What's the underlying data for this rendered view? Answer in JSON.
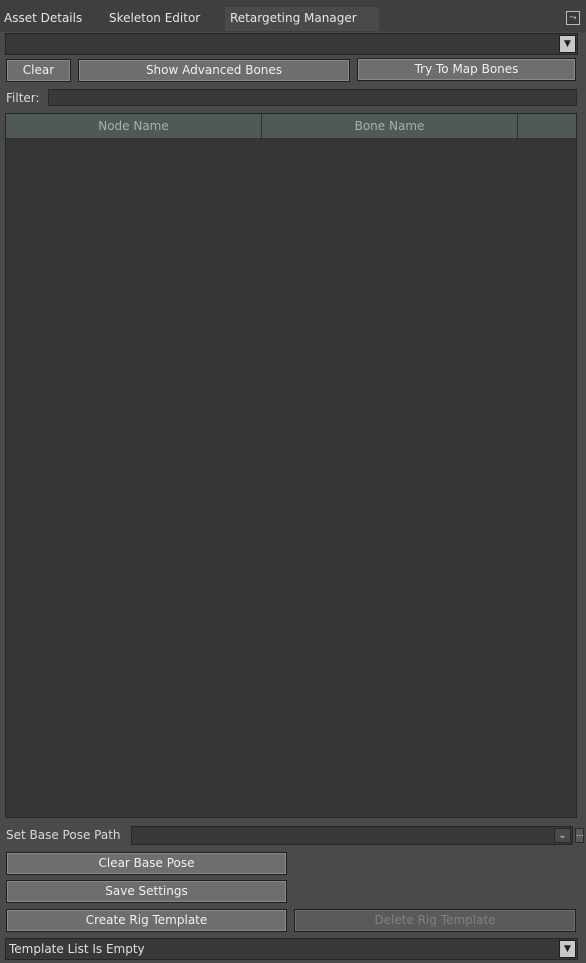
{
  "tabs": [
    {
      "label": "Asset Details"
    },
    {
      "label": "Skeleton Editor"
    },
    {
      "label": "Retargeting Manager",
      "active": true
    }
  ],
  "toolbar": {
    "clear_label": "Clear",
    "show_advanced_bones_label": "Show Advanced Bones",
    "try_to_map_bones_label": "Try To Map Bones"
  },
  "filter": {
    "label": "Filter:",
    "value": ""
  },
  "table": {
    "columns": [
      "Node Name",
      "Bone Name",
      ""
    ],
    "rows": []
  },
  "base_pose": {
    "label": "Set Base Pose Path",
    "value": "",
    "clear_label": "Clear Base Pose",
    "save_label": "Save Settings"
  },
  "rig": {
    "create_label": "Create Rig Template",
    "delete_label": "Delete Rig Template",
    "template_list_value": "Template List Is Empty"
  },
  "icons": {
    "dropdown": "chevron-down-icon",
    "pin": "pin-icon"
  },
  "colors": {
    "panel_bg": "#4a4a4a",
    "table_bg": "#363636",
    "header_bg": "#4e5a53",
    "button_bg": "#6e6e6e"
  }
}
